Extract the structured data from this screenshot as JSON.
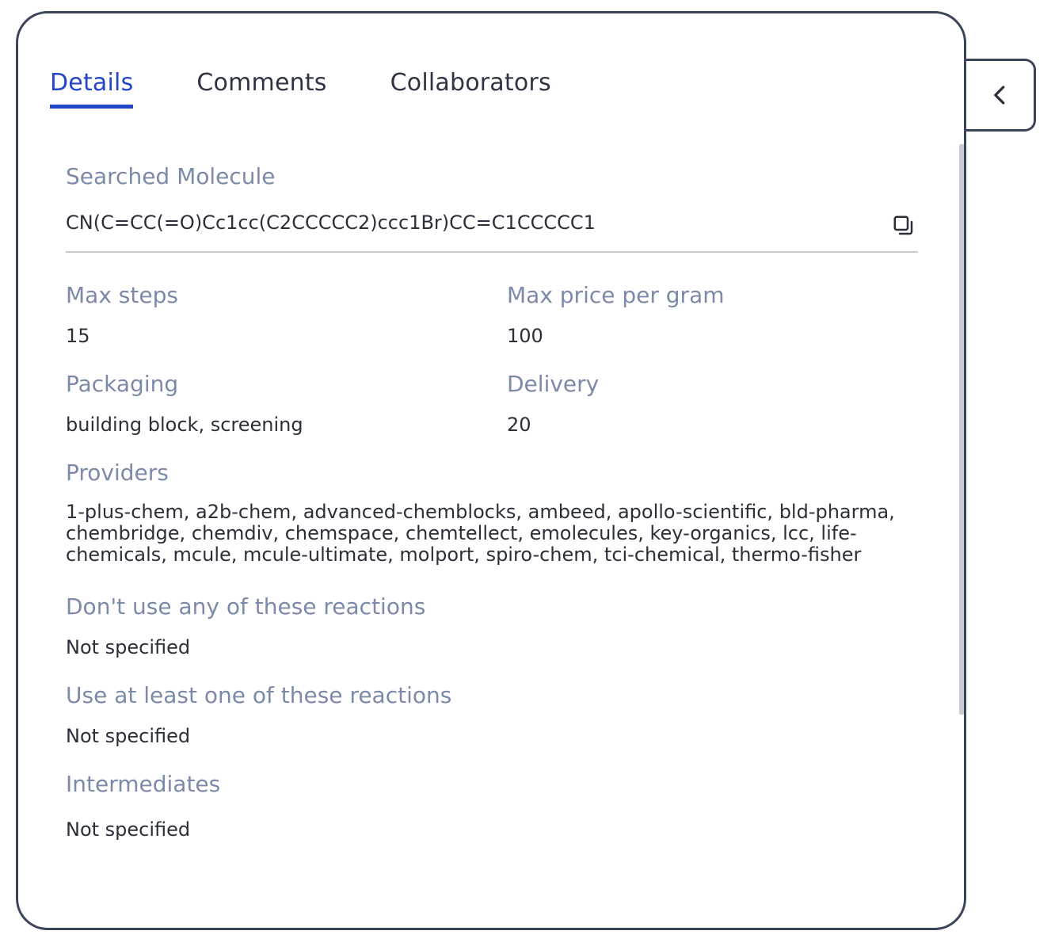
{
  "tabs": [
    {
      "label": "Details",
      "active": true
    },
    {
      "label": "Comments",
      "active": false
    },
    {
      "label": "Collaborators",
      "active": false
    }
  ],
  "details": {
    "searched_molecule": {
      "label": "Searched Molecule",
      "value": "CN(C=CC(=O)Cc1cc(C2CCCCC2)ccc1Br)CC=C1CCCCC1"
    },
    "max_steps": {
      "label": "Max steps",
      "value": "15"
    },
    "max_price_per_gram": {
      "label": "Max price per gram",
      "value": "100"
    },
    "packaging": {
      "label": "Packaging",
      "value": "building block, screening"
    },
    "delivery": {
      "label": "Delivery",
      "value": "20"
    },
    "providers": {
      "label": "Providers",
      "value": "1-plus-chem, a2b-chem, advanced-chemblocks, ambeed, apollo-scientific, bld-pharma, chembridge, chemdiv, chemspace, chemtellect, emolecules, key-organics, lcc, life-chemicals, mcule, mcule-ultimate, molport, spiro-chem, tci-chemical, thermo-fisher"
    },
    "excluded_reactions": {
      "label": "Don't use any of these reactions",
      "value": "Not specified"
    },
    "required_reactions": {
      "label": "Use at least one of these reactions",
      "value": "Not specified"
    },
    "intermediates": {
      "label": "Intermediates",
      "value": "Not specified"
    }
  },
  "icons": {
    "copy": "copy-icon",
    "collapse": "chevron-left-icon"
  },
  "colors": {
    "accent": "#2346c9",
    "label": "#7c8aa8",
    "border": "#3b4458"
  }
}
